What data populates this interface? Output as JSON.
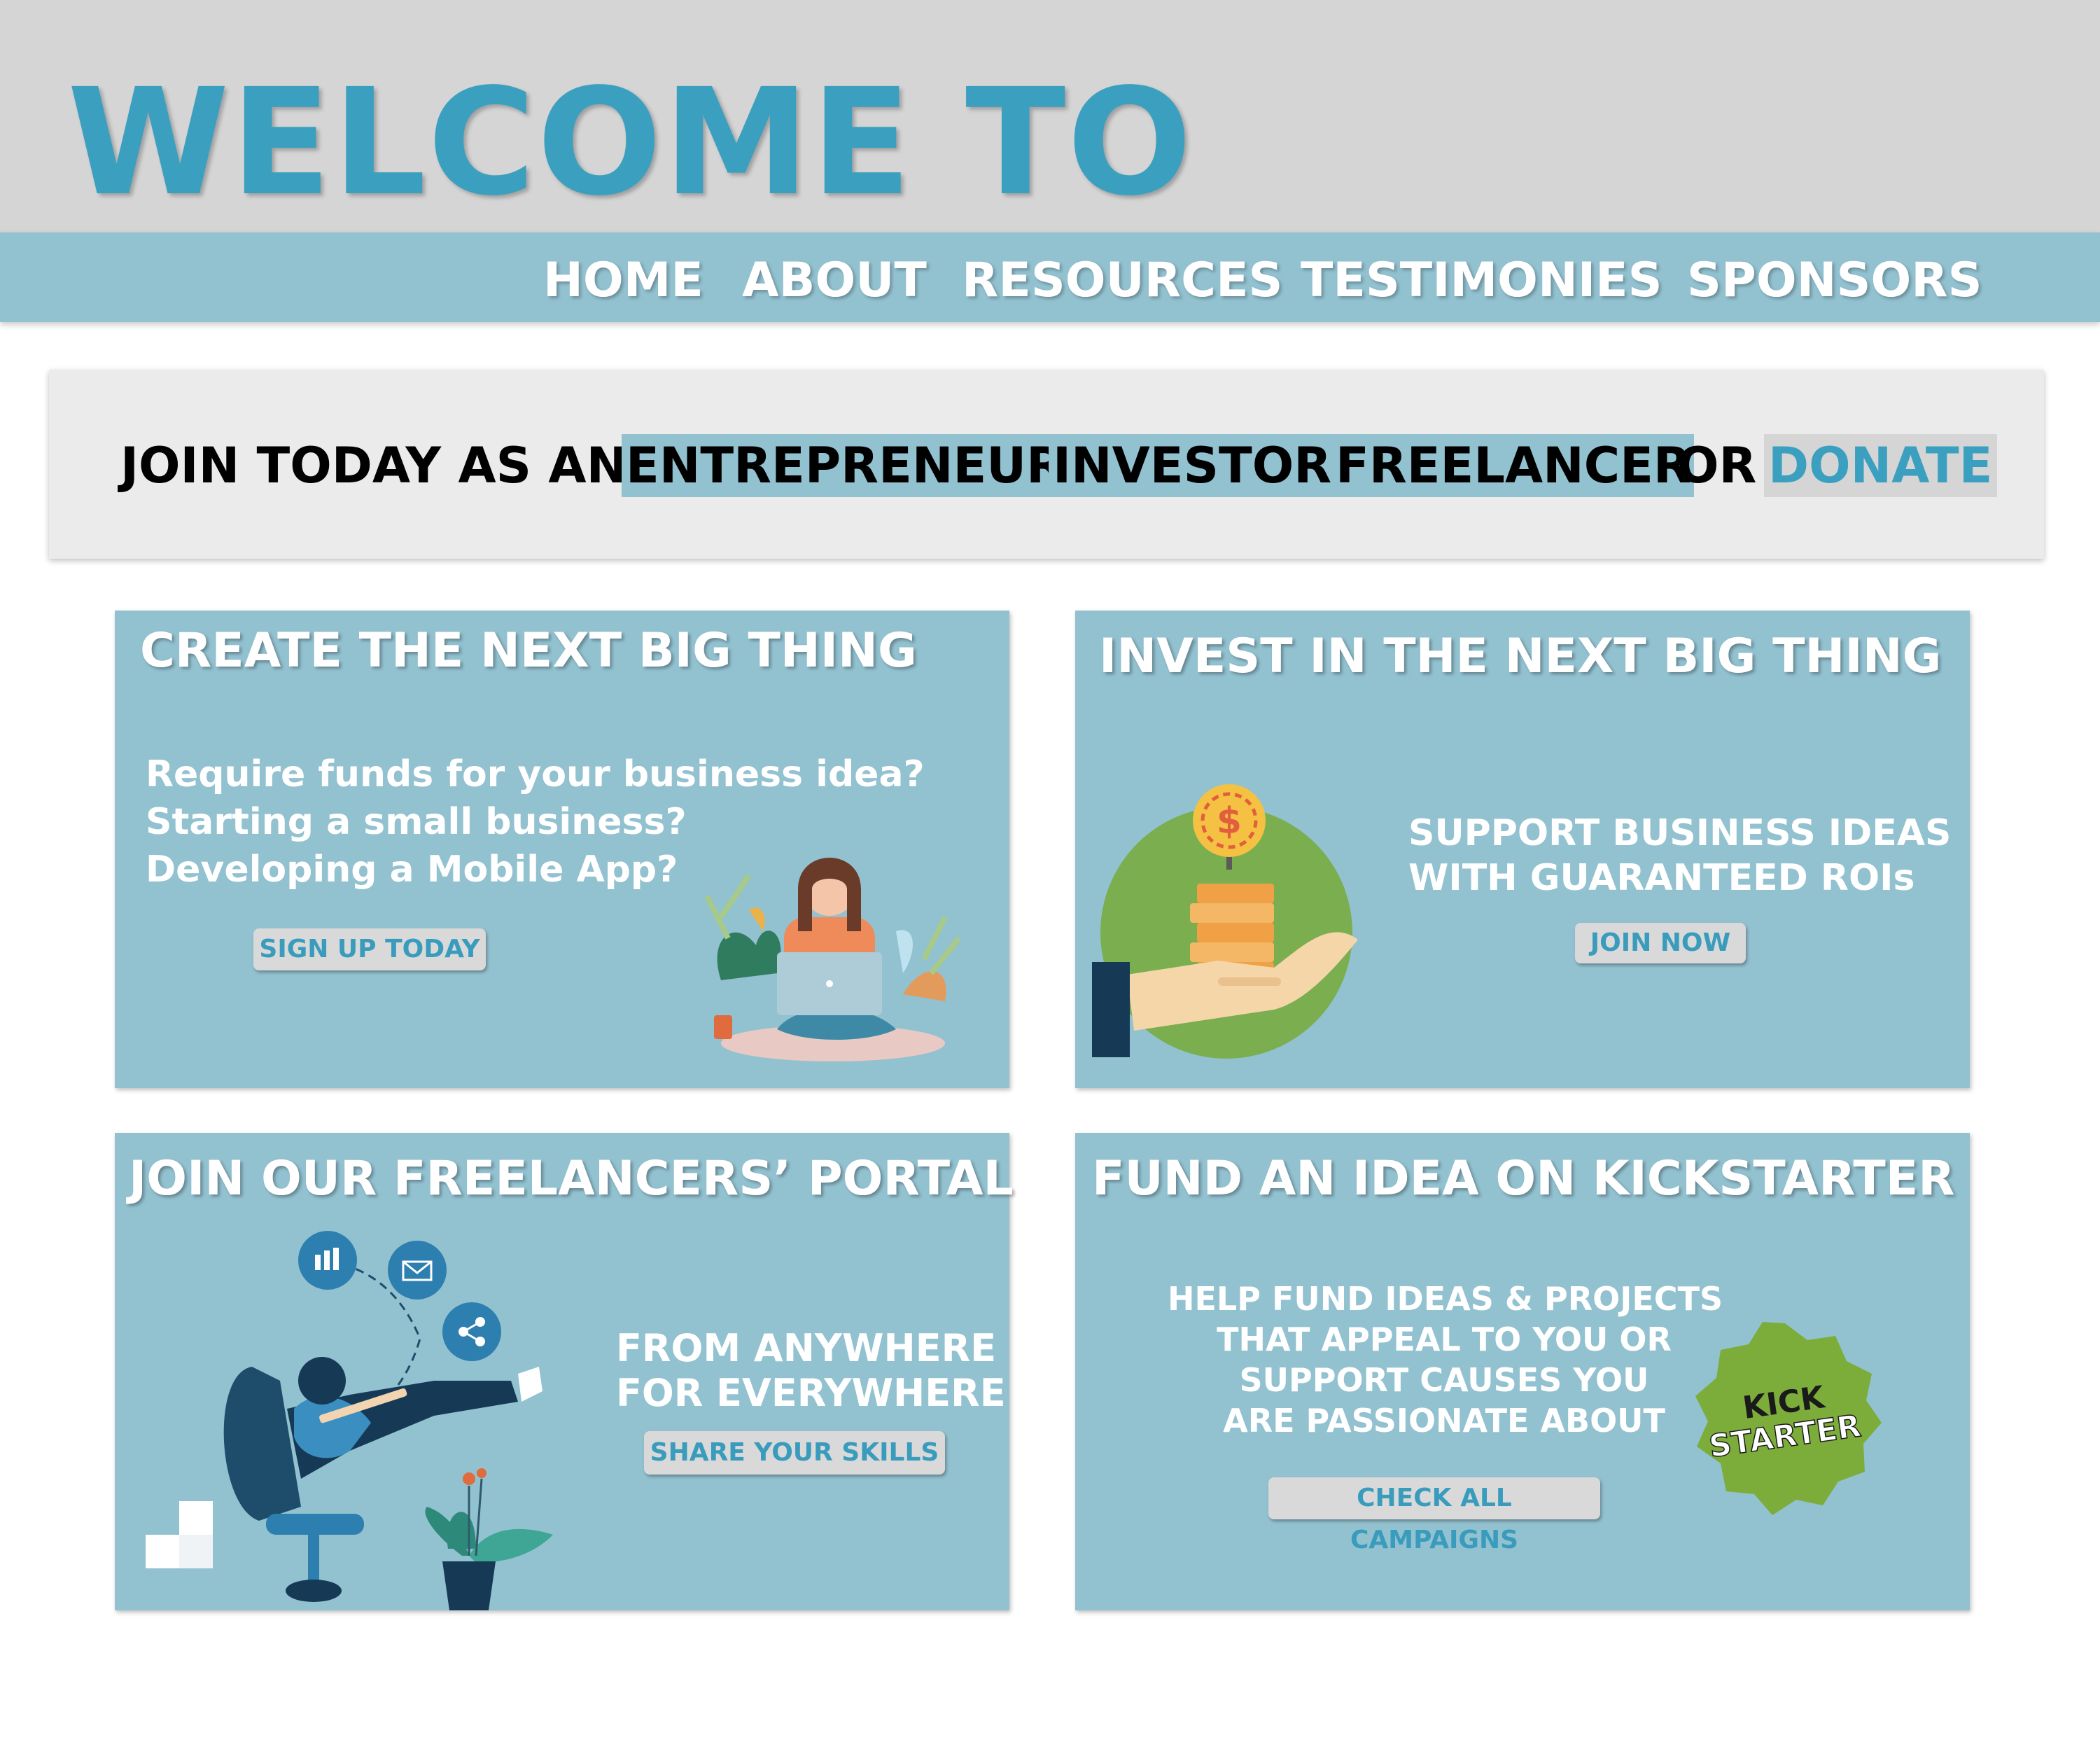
{
  "header": {
    "title": "WELCOME TO"
  },
  "nav": {
    "items": [
      "HOME",
      "ABOUT",
      "RESOURCES",
      "TESTIMONIES",
      "SPONSORS"
    ]
  },
  "join_banner": {
    "prefix": "JOIN TODAY AS AN",
    "role1": "ENTREPRENEUR",
    "role2": "INVESTOR",
    "role3": "FREELANCER",
    "or": "OR",
    "donate": "DONATE"
  },
  "cards": {
    "create": {
      "title": "CREATE THE NEXT BIG THING",
      "lines": [
        "Require funds for your business idea?",
        "Starting a small business?",
        "Developing a Mobile App?"
      ],
      "button": "SIGN UP TODAY"
    },
    "invest": {
      "title": "INVEST IN THE NEXT BIG THING",
      "lines": [
        "SUPPORT BUSINESS IDEAS",
        "WITH GUARANTEED ROIs"
      ],
      "button": "JOIN NOW",
      "coin_symbol": "$"
    },
    "freelancers": {
      "title": "JOIN OUR FREELANCERS’ PORTAL",
      "lines": [
        "FROM ANYWHERE",
        "FOR EVERYWHERE"
      ],
      "button": "SHARE YOUR SKILLS"
    },
    "kickstarter": {
      "title": "FUND AN IDEA ON KICKSTARTER",
      "lines": [
        "HELP FUND IDEAS & PROJECTS",
        "THAT APPEAL TO  YOU OR",
        "SUPPORT  CAUSES YOU",
        "ARE PASSIONATE ABOUT"
      ],
      "button": "CHECK ALL CAMPAIGNS",
      "badge_line1": "KICK",
      "badge_line2": "STARTER"
    }
  },
  "colors": {
    "accent": "#3ba0bf",
    "card": "#92c1d0",
    "header_bg": "#d5d5d5",
    "banner_bg": "#ebebeb",
    "kickstarter_green": "#7cad3a"
  }
}
